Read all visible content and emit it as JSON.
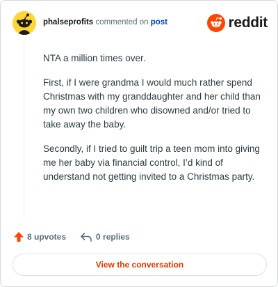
{
  "header": {
    "username": "phalseprofits",
    "action_text": "commented on",
    "target_link": "post",
    "brand_name": "reddit"
  },
  "comment": {
    "paragraphs": [
      "NTA a million times over.",
      "First, if I were grandma I would much rather spend Christmas with my granddaughter and her child than my own two children who disowned and/or tried to take away the baby.",
      "Secondly, if I tried to guilt trip a teen mom into giving me her baby via financial control, I’d kind of understand not getting invited to a Christmas party."
    ]
  },
  "actions": {
    "upvotes_label": "8 upvotes",
    "replies_label": "0 replies"
  },
  "cta": {
    "label": "View the conversation"
  },
  "colors": {
    "brand_orange": "#ff4500",
    "avatar_yellow": "#ffd635",
    "link_blue": "#0045ac",
    "cta_text": "#d93a00"
  },
  "icons": {
    "avatar": "snoo-avatar-icon",
    "brand": "reddit-logo-icon",
    "upvote": "upvote-arrow-icon",
    "reply": "reply-arrow-icon"
  }
}
